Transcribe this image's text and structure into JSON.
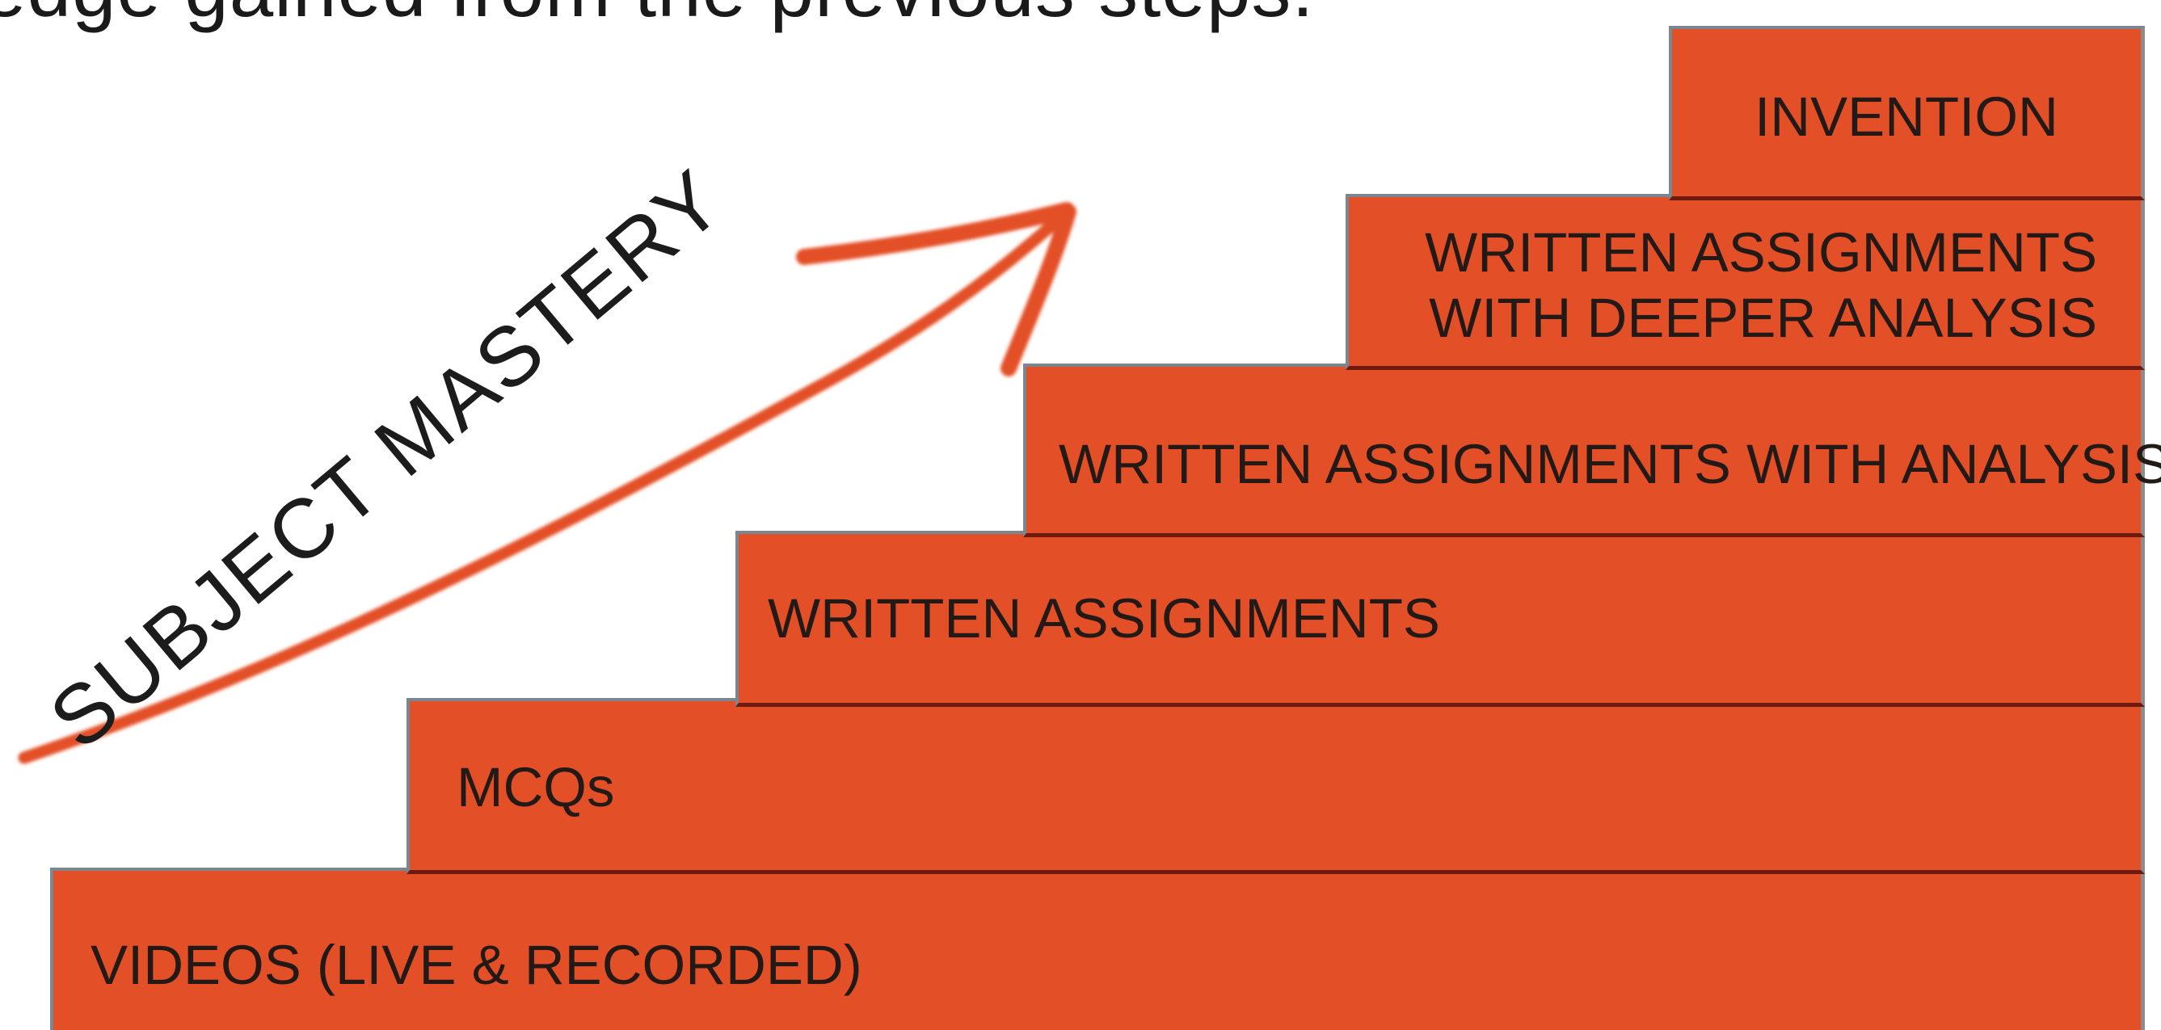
{
  "header": {
    "text": "edge gained from the previous steps."
  },
  "diagram": {
    "arrow_label": "SUBJECT MASTERY",
    "accent_color": "#e34f26",
    "text_color": "#231a17",
    "steps": [
      {
        "label": "VIDEOS (LIVE & RECORDED)"
      },
      {
        "label": "MCQs"
      },
      {
        "label": "WRITTEN ASSIGNMENTS"
      },
      {
        "label": "WRITTEN ASSIGNMENTS WITH ANALYSIS"
      },
      {
        "label": "WRITTEN ASSIGNMENTS\nWITH DEEPER ANALYSIS"
      },
      {
        "label": "INVENTION"
      }
    ]
  }
}
